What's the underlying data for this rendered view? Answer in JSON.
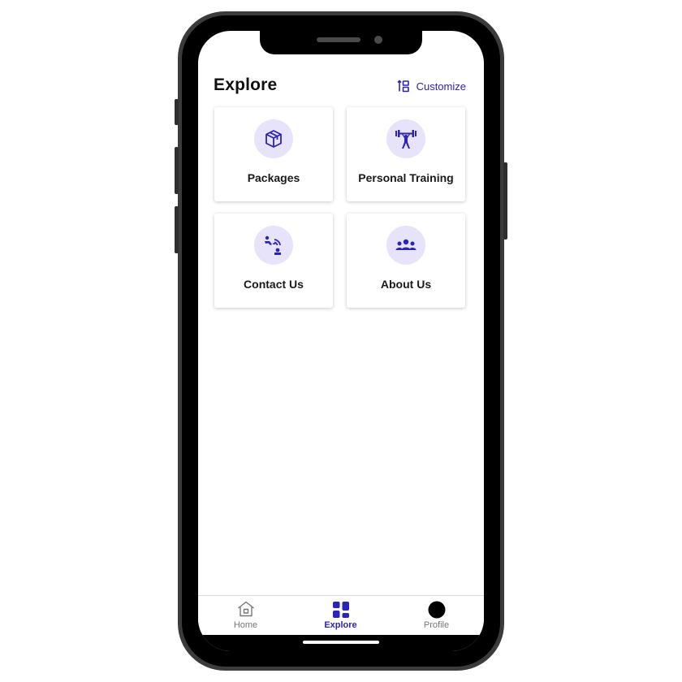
{
  "header": {
    "title": "Explore",
    "customize_label": "Customize"
  },
  "cards": [
    {
      "label": "Packages",
      "icon": "package-box-icon"
    },
    {
      "label": "Personal Training",
      "icon": "weightlifter-icon"
    },
    {
      "label": "Contact Us",
      "icon": "contact-call-icon"
    },
    {
      "label": "About Us",
      "icon": "group-people-icon"
    }
  ],
  "tabbar": {
    "items": [
      {
        "label": "Home",
        "icon": "home-icon",
        "active": false
      },
      {
        "label": "Explore",
        "icon": "explore-grid-icon",
        "active": true
      },
      {
        "label": "Profile",
        "icon": "profile-avatar-icon",
        "active": false
      }
    ]
  },
  "colors": {
    "accent": "#2c23b8",
    "icon_bg": "#e6e3fa",
    "frame": "#3b3b3b"
  }
}
